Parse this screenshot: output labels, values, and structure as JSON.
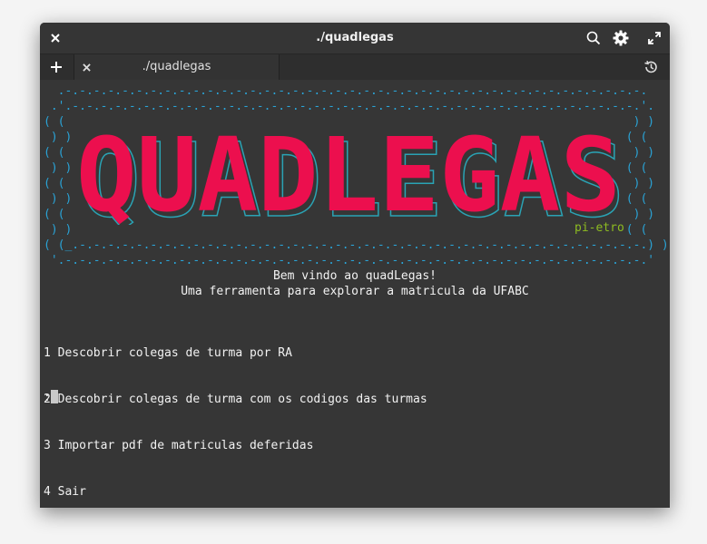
{
  "window": {
    "title": "./quadlegas"
  },
  "tab": {
    "label": "./quadlegas"
  },
  "terminal": {
    "banner_top_1": "  .-.-.-.-.-.-.-.-.-.-.-.-.-.-.-.-.-.-.-.-.-.-.-.-.-.-.-.-.-.-.-.-.-.-.-.-.-.-.-.-.-.",
    "banner_top_2": " .'.-.-.-.-.-.-.-.-.-.-.-.-.-.-.-.-.-.-.-.-.-.-.-.-.-.-.-.-.-.-.-.-.-.-.-.-.-.-.-.-.'.",
    "banner_bottom_1": "( (_.-.-.-.-.-.-.-.-.-.-.-.-.-.-.-.-.-.-.-.-.-.-.-.-.-.-.-.-.-.-.-.-.-.-.-.-.-.-.-.-.) )",
    "banner_bottom_2": " '.-.-.-.-.-.-.-.-.-.-.-.-.-.-.-.-.-.-.-.-.-.-.-.-.-.-.-.-.-.-.-.-.-.-.-.-.-.-.-.-.-.'",
    "logo_text": "QUADLEGAS",
    "author": "pi-etro",
    "welcome": "Bem vindo ao quadLegas!",
    "subtitle": "Uma ferramenta para explorar a matricula da UFABC",
    "menu": [
      "1 Descobrir colegas de turma por RA",
      "2 Descobrir colegas de turma com os codigos das turmas",
      "3 Importar pdf de matriculas deferidas",
      "4 Sair"
    ],
    "prompt": ":"
  },
  "colors": {
    "logo": "#ec0f4e",
    "logo_shadow": "#2aa3b4",
    "wave": "#2aa3d6",
    "author": "#8dbb21",
    "background": "#363636"
  },
  "icons": [
    "close-icon",
    "search-icon",
    "gear-icon",
    "maximize-icon",
    "new-tab-icon",
    "tab-close-icon",
    "history-icon"
  ]
}
